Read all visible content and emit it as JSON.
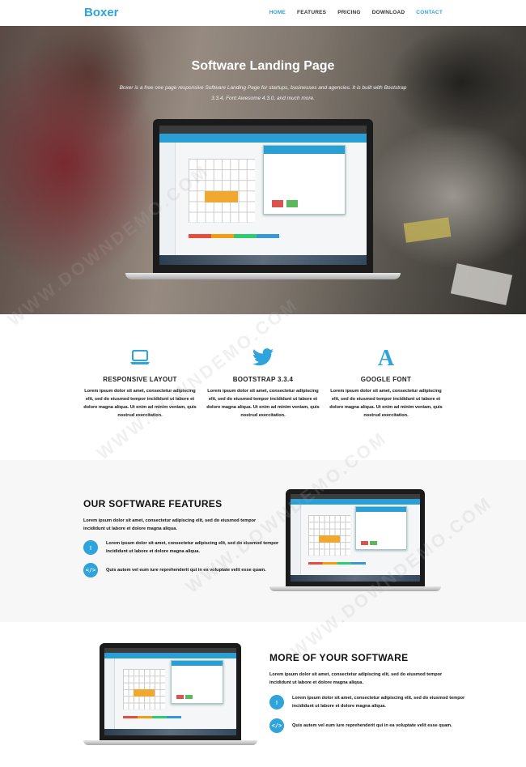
{
  "nav": {
    "logo": "Boxer",
    "links": [
      "HOME",
      "FEATURES",
      "PRICING",
      "DOWNLOAD",
      "CONTACT"
    ]
  },
  "hero": {
    "title": "Software Landing Page",
    "text": "Boxer is a free one page responsive Software Landing Page for startups, businesses and agencies. It is built with Bootstrap 3.3.4, Font Awesome 4.3.0, and much more."
  },
  "features": [
    {
      "icon": "laptop-icon",
      "title": "RESPONSIVE LAYOUT",
      "text": "Lorem ipsum dolor sit amet, consectetur adipiscing elit, sed do eiusmod tempor incididunt ut labore et dolore magna aliqua. Ut enim ad minim veniam, quis nostrud exercitation."
    },
    {
      "icon": "twitter-icon",
      "title": "BOOTSTRAP 3.3.4",
      "text": "Lorem ipsum dolor sit amet, consectetur adipiscing elit, sed do eiusmod tempor incididunt ut labore et dolore magna aliqua. Ut enim ad minim veniam, quis nostrud exercitation."
    },
    {
      "icon": "font-icon",
      "title": "GOOGLE FONT",
      "text": "Lorem ipsum dolor sit amet, consectetur adipiscing elit, sed do eiusmod tempor incididunt ut labore et dolore magna aliqua. Ut enim ad minim veniam, quis nostrud exercitation."
    }
  ],
  "software_features": {
    "title": "OUR SOFTWARE FEATURES",
    "intro": "Lorem ipsum dolor sit amet, consectetur adipiscing elit, sed do eiusmod tempor incididunt ut labore et dolore magna aliqua.",
    "bullets": [
      {
        "icon": "mobile-icon",
        "glyph": "▯",
        "text": "Lorem ipsum dolor sit amet, consectetur adipiscing elit, sed do eiusmod tempor incididunt ut labore et dolore magna aliqua."
      },
      {
        "icon": "code-icon",
        "glyph": "</>",
        "text": "Quis autem vel eum iure reprehenderit qui in ea voluptate velit esse quam."
      }
    ]
  },
  "more_software": {
    "title": "MORE OF YOUR SOFTWARE",
    "intro": "Lorem ipsum dolor sit amet, consectetur adipiscing elit, sed do eiusmod tempor incididunt ut labore et dolore magna aliqua.",
    "bullets": [
      {
        "icon": "mobile-icon",
        "glyph": "▯",
        "text": "Lorem ipsum dolor sit amet, consectetur adipiscing elit, sed do eiusmod tempor incididunt ut labore et dolore magna aliqua."
      },
      {
        "icon": "code-icon",
        "glyph": "</>",
        "text": "Quis autem vel eum iure reprehenderit qui in ea voluptate velit esse quam."
      }
    ]
  },
  "watermark": "WWW.DOWNDEMO.COM",
  "colors": {
    "accent": "#2ea3dc",
    "section_bg": "#f7f7f7"
  }
}
